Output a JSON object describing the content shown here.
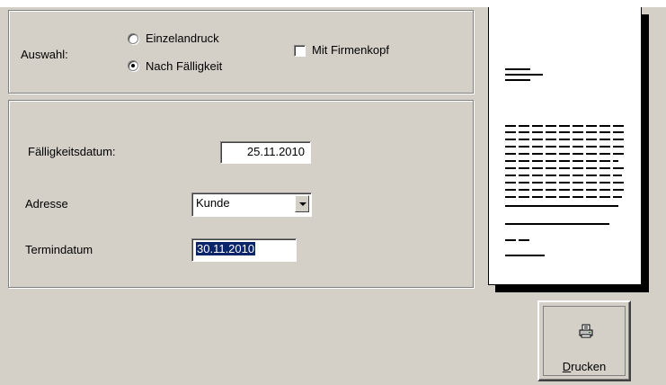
{
  "selection": {
    "label": "Auswahl:",
    "options": [
      "Einzelandruck",
      "Nach Fälligkeit"
    ],
    "selected": "Nach Fälligkeit",
    "letterhead_label": "Mit Firmenkopf",
    "letterhead_checked": false
  },
  "form": {
    "due_date_label": "Fälligkeitsdatum:",
    "due_date_value": "25.11.2010",
    "address_label": "Adresse",
    "address_value": "Kunde",
    "appointment_label": "Termindatum",
    "appointment_value": "30.11.2010"
  },
  "print_button": {
    "mnemonic": "D",
    "rest": "rucken",
    "icon": "printer-icon"
  },
  "colors": {
    "background": "#d4d0c8",
    "selection_highlight": "#0a246a"
  }
}
